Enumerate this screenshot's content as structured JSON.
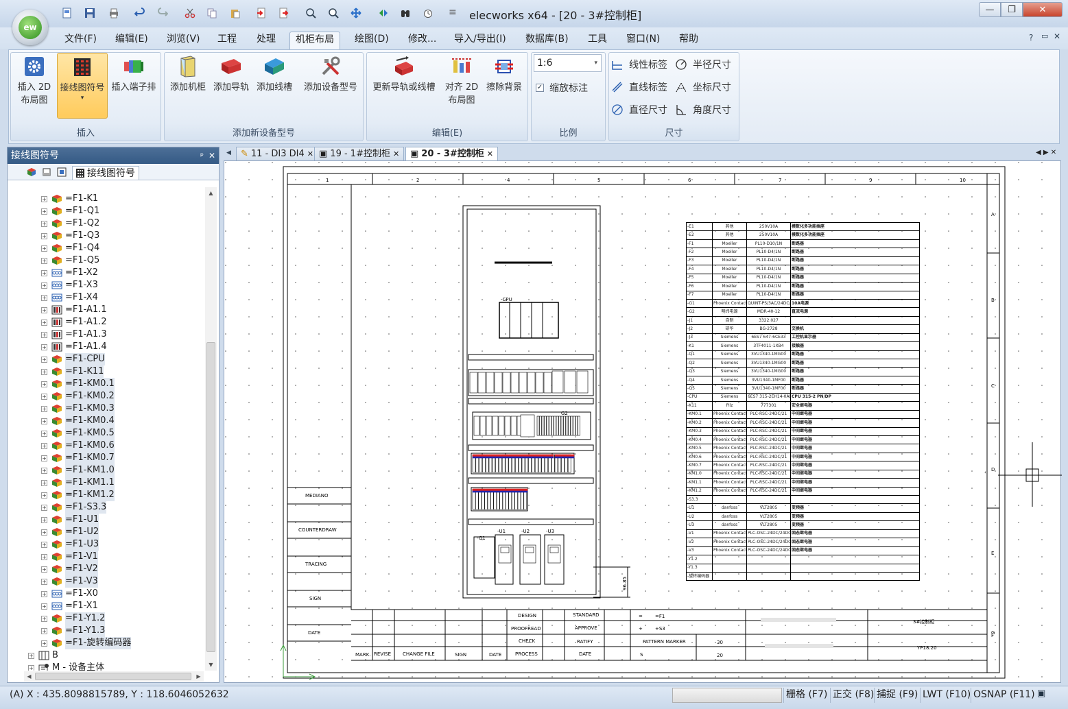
{
  "app": {
    "title": "elecworks x64 - [20 - 3#控制柜]",
    "logo_text": "ew"
  },
  "window_controls": {
    "minimize": "—",
    "restore": "❐",
    "close": "✕"
  },
  "menu": {
    "items": [
      {
        "label": "文件(F)"
      },
      {
        "label": "编辑(E)"
      },
      {
        "label": "浏览(V)"
      },
      {
        "label": "工程"
      },
      {
        "label": "处理"
      },
      {
        "label": "机柜布局"
      },
      {
        "label": "绘图(D)"
      },
      {
        "label": "修改..."
      },
      {
        "label": "导入/导出(I)"
      },
      {
        "label": "数据库(B)"
      },
      {
        "label": "工具"
      },
      {
        "label": "窗口(N)"
      },
      {
        "label": "帮助"
      }
    ],
    "help_icon": "?"
  },
  "ribbon": {
    "groups": {
      "insert": "插入",
      "add_new": "添加新设备型号",
      "edit": "编辑(E)",
      "scale": "比例",
      "dimension": "尺寸"
    },
    "buttons": {
      "insert_2d_l1": "插入 2D",
      "insert_2d_l2": "布局图",
      "wiring_symbol": "接线图符号",
      "terminal_strip": "插入端子排",
      "add_cabinet": "添加机柜",
      "add_rail": "添加导轨",
      "add_duct": "添加线槽",
      "add_device_model": "添加设备型号",
      "update_rail_duct": "更新导轨或线槽",
      "align_2d_l1": "对齐 2D",
      "align_2d_l2": "布局图",
      "erase_bg": "擦除背景"
    },
    "scale": {
      "value": "1:6",
      "checkbox_label": "缩放标注",
      "checked": true
    },
    "dims": {
      "linear": "线性标签",
      "radius": "半径尺寸",
      "aligned": "直线标签",
      "ordinate": "坐标尺寸",
      "diameter": "直径尺寸",
      "angular": "角度尺寸"
    }
  },
  "panel": {
    "title": "接线图符号",
    "pin": "ᵖ",
    "close": "✕",
    "tab_label": "接线图符号",
    "tree": [
      {
        "label": "=F1-K1",
        "icon": "component",
        "hl": false
      },
      {
        "label": "=F1-Q1",
        "icon": "component",
        "hl": false
      },
      {
        "label": "=F1-Q2",
        "icon": "component",
        "hl": false
      },
      {
        "label": "=F1-Q3",
        "icon": "component",
        "hl": false
      },
      {
        "label": "=F1-Q4",
        "icon": "component",
        "hl": false
      },
      {
        "label": "=F1-Q5",
        "icon": "component",
        "hl": false
      },
      {
        "label": "=F1-X2",
        "icon": "terminal",
        "hl": false
      },
      {
        "label": "=F1-X3",
        "icon": "terminal",
        "hl": false
      },
      {
        "label": "=F1-X4",
        "icon": "terminal",
        "hl": false
      },
      {
        "label": "=F1-A1.1",
        "icon": "plc",
        "hl": false
      },
      {
        "label": "=F1-A1.2",
        "icon": "plc",
        "hl": false
      },
      {
        "label": "=F1-A1.3",
        "icon": "plc",
        "hl": false
      },
      {
        "label": "=F1-A1.4",
        "icon": "plc",
        "hl": false
      },
      {
        "label": "=F1-CPU",
        "icon": "component",
        "hl": true
      },
      {
        "label": "=F1-K11",
        "icon": "component",
        "hl": true
      },
      {
        "label": "=F1-KM0.1",
        "icon": "component",
        "hl": true
      },
      {
        "label": "=F1-KM0.2",
        "icon": "component",
        "hl": true
      },
      {
        "label": "=F1-KM0.3",
        "icon": "component",
        "hl": true
      },
      {
        "label": "=F1-KM0.4",
        "icon": "component",
        "hl": true
      },
      {
        "label": "=F1-KM0.5",
        "icon": "component",
        "hl": true
      },
      {
        "label": "=F1-KM0.6",
        "icon": "component",
        "hl": true
      },
      {
        "label": "=F1-KM0.7",
        "icon": "component",
        "hl": true
      },
      {
        "label": "=F1-KM1.0",
        "icon": "component",
        "hl": true
      },
      {
        "label": "=F1-KM1.1",
        "icon": "component",
        "hl": true
      },
      {
        "label": "=F1-KM1.2",
        "icon": "component",
        "hl": true
      },
      {
        "label": "=F1-S3.3",
        "icon": "component",
        "hl": true
      },
      {
        "label": "=F1-U1",
        "icon": "component",
        "hl": true
      },
      {
        "label": "=F1-U2",
        "icon": "component",
        "hl": true
      },
      {
        "label": "=F1-U3",
        "icon": "component",
        "hl": true
      },
      {
        "label": "=F1-V1",
        "icon": "component",
        "hl": true
      },
      {
        "label": "=F1-V2",
        "icon": "component",
        "hl": true
      },
      {
        "label": "=F1-V3",
        "icon": "component",
        "hl": true
      },
      {
        "label": "=F1-X0",
        "icon": "terminal",
        "hl": false
      },
      {
        "label": "=F1-X1",
        "icon": "terminal",
        "hl": false
      },
      {
        "label": "=F1-Y1.2",
        "icon": "component",
        "hl": true
      },
      {
        "label": "=F1-Y1.3",
        "icon": "component",
        "hl": true
      },
      {
        "label": "=F1-旋转编码器",
        "icon": "component",
        "hl": true
      },
      {
        "label": "B",
        "icon": "folder",
        "hl": false
      },
      {
        "label": "M - 设备主体",
        "icon": "folder2",
        "hl": false
      }
    ]
  },
  "doc_tabs": [
    {
      "label": "11 - DI3 DI4",
      "active": false
    },
    {
      "label": "19 - 1#控制柜",
      "active": false
    },
    {
      "label": "20 - 3#控制柜",
      "active": true
    }
  ],
  "drawing": {
    "col_numbers": [
      "1",
      "2",
      "4",
      "5",
      "6",
      "7",
      "9",
      "10"
    ],
    "row_letters": [
      "A",
      "B",
      "C",
      "D",
      "E",
      "F",
      "G"
    ],
    "left_labels": [
      "MEDIANO",
      "COUNTERDRAW",
      "TRACING",
      "SIGN",
      "DATE"
    ],
    "cpu_label": "-CPU",
    "u_labels": [
      "-U1",
      "-U2",
      "-U3"
    ],
    "g_label": "-G1",
    "g2_label": "G2",
    "dim_text": "96.85",
    "bom": [
      [
        "-E1",
        "其他",
        "250V10A",
        "模数化多功能插座"
      ],
      [
        "-E2",
        "其他",
        "250V10A",
        "模数化多功能插座"
      ],
      [
        "-F1",
        "Moeller",
        "PL10-D10/1N",
        "断路器"
      ],
      [
        "-F2",
        "Moeller",
        "PL10-D4/1N",
        "断路器"
      ],
      [
        "-F3",
        "Moeller",
        "PL10-D4/1N",
        "断路器"
      ],
      [
        "-F4",
        "Moeller",
        "PL10-D4/1N",
        "断路器"
      ],
      [
        "-F5",
        "Moeller",
        "PL10-D4/1N",
        "断路器"
      ],
      [
        "-F6",
        "Moeller",
        "PL10-D4/1N",
        "断路器"
      ],
      [
        "-F7",
        "Moeller",
        "PL10-D4/1N",
        "断路器"
      ],
      [
        "-G1",
        "Phoenix Contact",
        "QUINT-PS/3AC/24DC/10",
        "10A电源"
      ],
      [
        "-G2",
        "明纬电源",
        "MDR-40-12",
        "直流电源"
      ],
      [
        "-J1",
        "自制",
        "3322.027",
        ""
      ],
      [
        "-J2",
        "研华",
        "BG-2728",
        "交换机"
      ],
      [
        "-J3",
        "Siemens",
        "6ES7 647-6CE33",
        "工控机显示器"
      ],
      [
        "-K1",
        "Siemens",
        "3TF4011-1XB4",
        "接触器"
      ],
      [
        "-Q1",
        "Siemens",
        "3VU1340-1MG00",
        "断路器"
      ],
      [
        "-Q2",
        "Siemens",
        "3VU1340-1MG00",
        "断路器"
      ],
      [
        "-Q3",
        "Siemens",
        "3VU1340-1MG00",
        "断路器"
      ],
      [
        "-Q4",
        "Siemens",
        "3VU1340-1MF00",
        "断路器"
      ],
      [
        "-Q5",
        "Siemens",
        "3VU1340-1MF00",
        "断路器"
      ],
      [
        "-CPU",
        "Siemens",
        "6ES7 315-2EH14-0AB0",
        "CPU 315-2 PN/DP"
      ],
      [
        "-K11",
        "Pilz",
        "777301",
        "安全继电器"
      ],
      [
        "-KM0.1",
        "Phoenix Contact",
        "PLC-RSC-24DC/21",
        "中间继电器"
      ],
      [
        "-KM0.2",
        "Phoenix Contact",
        "PLC-RSC-24DC/21",
        "中间继电器"
      ],
      [
        "-KM0.3",
        "Phoenix Contact",
        "PLC-RSC-24DC/21",
        "中间继电器"
      ],
      [
        "-KM0.4",
        "Phoenix Contact",
        "PLC-RSC-24DC/21",
        "中间继电器"
      ],
      [
        "-KM0.5",
        "Phoenix Contact",
        "PLC-RSC-24DC/21",
        "中间继电器"
      ],
      [
        "-KM0.6",
        "Phoenix Contact",
        "PLC-RSC-24DC/21",
        "中间继电器"
      ],
      [
        "-KM0.7",
        "Phoenix Contact",
        "PLC-RSC-24DC/21",
        "中间继电器"
      ],
      [
        "-KM1.0",
        "Phoenix Contact",
        "PLC-RSC-24DC/21",
        "中间继电器"
      ],
      [
        "-KM1.1",
        "Phoenix Contact",
        "PLC-RSC-24DC/21",
        "中间继电器"
      ],
      [
        "-KM1.2",
        "Phoenix Contact",
        "PLC-RSC-24DC/21",
        "中间继电器"
      ],
      [
        "-S3.3",
        "",
        "",
        ""
      ],
      [
        "-U1",
        "danfoss",
        "VLT2805",
        "变频器"
      ],
      [
        "-U2",
        "danfoss",
        "VLT2805",
        "变频器"
      ],
      [
        "-U3",
        "danfoss",
        "VLT2805",
        "变频器"
      ],
      [
        "-V1",
        "Phoenix Contact",
        "PLC-OSC-24DC/24DC/5/ACT",
        "固态继电器"
      ],
      [
        "-V2",
        "Phoenix Contact",
        "PLC-OSC-24DC/24DC/5/ACT",
        "固态继电器"
      ],
      [
        "-V3",
        "Phoenix Contact",
        "PLC-OSC-24DC/24DC/5/ACT",
        "固态继电器"
      ],
      [
        "-Y1.2",
        "",
        "",
        ""
      ],
      [
        "-Y1.3",
        "",
        "",
        ""
      ],
      [
        "-旋转编码器",
        "",
        "",
        ""
      ]
    ],
    "title_block": {
      "design": "DESIGN",
      "standard": "STANDARD",
      "proofread": "PROOFREAD",
      "approve": "APPROVE",
      "check": "CHECK",
      "ratify": "RATIFY",
      "process": "PROCESS",
      "date": "DATE",
      "mark": "MARK.",
      "revise": "REVISE",
      "change_file": "CHANGE FILE",
      "sign": "SIGN",
      "date2": "DATE",
      "eq1": "=",
      "f1": "=F1",
      "plus": "+",
      "s3": "+S3",
      "pattern_marker": "PATTERN MARKER",
      "n30": "30",
      "s_letter": "S",
      "n20": "20",
      "drawing_name": "3#控制柜",
      "ref": "YP18.20"
    }
  },
  "status": {
    "coords": "(A) X : 435.8098815789, Y : 118.6046052632",
    "grid": "栅格 (F7)",
    "ortho": "正交 (F8)",
    "snap": "捕捉 (F9)",
    "lwt": "LWT (F10)",
    "osnap": "OSNAP (F11)"
  }
}
